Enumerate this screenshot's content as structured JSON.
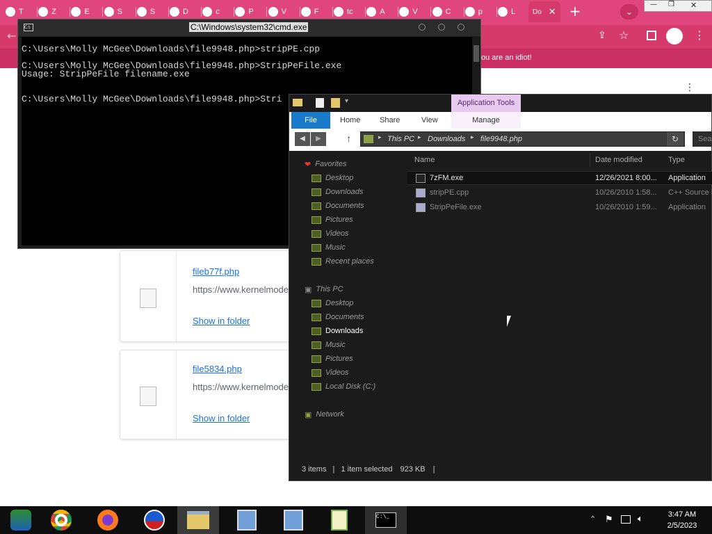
{
  "browser": {
    "tabs": [
      {
        "letter": "T"
      },
      {
        "letter": "Z"
      },
      {
        "letter": "E"
      },
      {
        "letter": "S"
      },
      {
        "letter": "S"
      },
      {
        "letter": "D"
      },
      {
        "letter": "c"
      },
      {
        "letter": "P"
      },
      {
        "letter": "V"
      },
      {
        "letter": "F"
      },
      {
        "letter": "tc"
      },
      {
        "letter": "A"
      },
      {
        "letter": "V"
      },
      {
        "letter": "C"
      },
      {
        "letter": "p"
      },
      {
        "letter": "L"
      }
    ],
    "active_tab": "Do",
    "new_tab_symbol": "+",
    "banner_text": "ou are an idiot!",
    "colors": {
      "tabstrip": "#e0457b",
      "toolbar": "#d63a6c"
    }
  },
  "downloads": [
    {
      "name": "fileb77f.php",
      "url": "https://www.kernelmode",
      "action": "Show in folder"
    },
    {
      "name": "file5834.php",
      "url": "https://www.kernelmode",
      "action": "Show in folder"
    }
  ],
  "cmd": {
    "title": "C:\\Windows\\system32\\cmd.exe",
    "lines": [
      "C:\\Users\\Molly McGee\\Downloads\\file9948.php>stripPE.cpp",
      "",
      "C:\\Users\\Molly McGee\\Downloads\\file9948.php>StripPeFile.exe",
      "Usage: StripPeFile filename.exe",
      "",
      "",
      "C:\\Users\\Molly McGee\\Downloads\\file9948.php>Stri"
    ]
  },
  "explorer": {
    "ribbon": {
      "context_label": "Application Tools",
      "tabs": [
        "File",
        "Home",
        "Share",
        "View",
        "Manage"
      ]
    },
    "address": [
      "This PC",
      "Downloads",
      "file9948.php"
    ],
    "search_placeholder": "Sea",
    "nav": {
      "favorites_label": "Favorites",
      "favorites": [
        "Desktop",
        "Downloads",
        "Documents",
        "Pictures",
        "Videos",
        "Music",
        "Recent places"
      ],
      "thispc_label": "This PC",
      "thispc": [
        "Desktop",
        "Documents",
        "Downloads",
        "Music",
        "Pictures",
        "Videos",
        "Local Disk (C:)"
      ],
      "network_label": "Network"
    },
    "columns": [
      "Name",
      "Date modified",
      "Type"
    ],
    "files": [
      {
        "name": "7zFM.exe",
        "date": "12/26/2021 8:00...",
        "type": "Application"
      },
      {
        "name": "stripPE.cpp",
        "date": "10/26/2010 1:58...",
        "type": "C++ Source F"
      },
      {
        "name": "StripPeFile.exe",
        "date": "10/26/2010 1:59...",
        "type": "Application"
      }
    ],
    "status": {
      "count": "3 items",
      "selected": "1 item selected",
      "size": "923 KB"
    }
  },
  "taskbar": {
    "time": "3:47 AM",
    "date": "2/5/2023"
  }
}
